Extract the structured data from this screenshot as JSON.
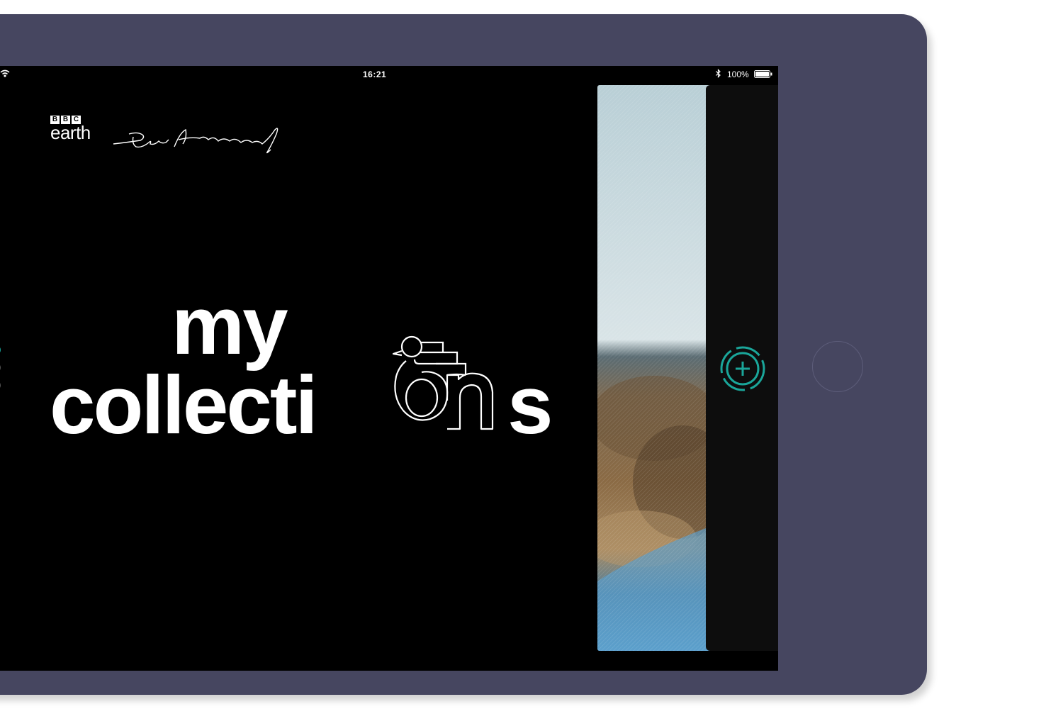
{
  "status_bar": {
    "device": "iPad",
    "time": "16:21",
    "battery": "100%"
  },
  "brand": {
    "bbc_letters": [
      "B",
      "B",
      "C"
    ],
    "product": "earth",
    "signature": "David Attenborough"
  },
  "title": {
    "line1": "my",
    "line2_prefix": "collecti",
    "line2_suffix": "s",
    "decorated_letters": "on"
  },
  "page_indicator": {
    "count": 3,
    "active_index": 0
  },
  "icons": {
    "wifi": "wifi-icon",
    "bluetooth": "bluetooth-icon",
    "battery": "battery-icon",
    "add": "add-circle-icon",
    "bird": "bird-icon"
  },
  "colors": {
    "accent": "#1aa69a",
    "device_frame": "#464660",
    "screen": "#000000",
    "text": "#ffffff"
  }
}
